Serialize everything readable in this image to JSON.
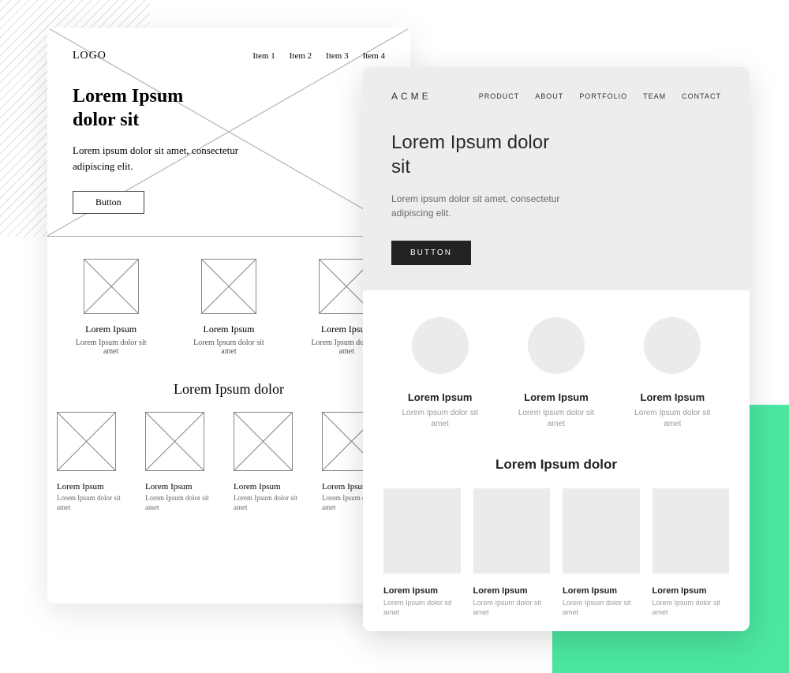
{
  "wireframe": {
    "logo": "LOGO",
    "nav": [
      "Item 1",
      "Item 2",
      "Item 3",
      "Item 4"
    ],
    "hero": {
      "title": "Lorem Ipsum dolor sit",
      "subtitle": "Lorem ipsum dolor sit amet, consectetur adipiscing elit.",
      "button": "Button"
    },
    "features": [
      {
        "title": "Lorem Ipsum",
        "sub": "Lorem Ipsum dolor sit amet"
      },
      {
        "title": "Lorem Ipsum",
        "sub": "Lorem Ipsum dolor sit amet"
      },
      {
        "title": "Lorem Ipsum",
        "sub": "Lorem Ipsum dolor sit amet"
      }
    ],
    "section_title": "Lorem Ipsum dolor",
    "portfolio": [
      {
        "title": "Lorem Ipsum",
        "sub": "Lorem Ipsum dolor sit amet"
      },
      {
        "title": "Lorem Ipsum",
        "sub": "Lorem Ipsum dolor sit amet"
      },
      {
        "title": "Lorem Ipsum",
        "sub": "Lorem Ipsum dolor sit amet"
      },
      {
        "title": "Lorem Ipsum",
        "sub": "Lorem Ipsum dolor sit amet"
      }
    ]
  },
  "mockup": {
    "logo": "ACME",
    "nav": [
      "PRODUCT",
      "ABOUT",
      "PORTFOLIO",
      "TEAM",
      "CONTACT"
    ],
    "hero": {
      "title": "Lorem Ipsum dolor sit",
      "subtitle": "Lorem ipsum dolor sit amet, consectetur adipiscing elit.",
      "button": "BUTTON"
    },
    "features": [
      {
        "title": "Lorem Ipsum",
        "sub": "Lorem Ipsum dolor sit amet"
      },
      {
        "title": "Lorem Ipsum",
        "sub": "Lorem Ipsum dolor sit amet"
      },
      {
        "title": "Lorem Ipsum",
        "sub": "Lorem Ipsum dolor sit amet"
      }
    ],
    "section_title": "Lorem Ipsum dolor",
    "portfolio": [
      {
        "title": "Lorem Ipsum",
        "sub": "Lorem Ipsum dolor sit amet"
      },
      {
        "title": "Lorem Ipsum",
        "sub": "Lorem Ipsum dolor sit amet"
      },
      {
        "title": "Lorem Ipsum",
        "sub": "Lorem Ipsum dolor sit amet"
      },
      {
        "title": "Lorem Ipsum",
        "sub": "Lorem Ipsum dolor sit amet"
      }
    ]
  }
}
